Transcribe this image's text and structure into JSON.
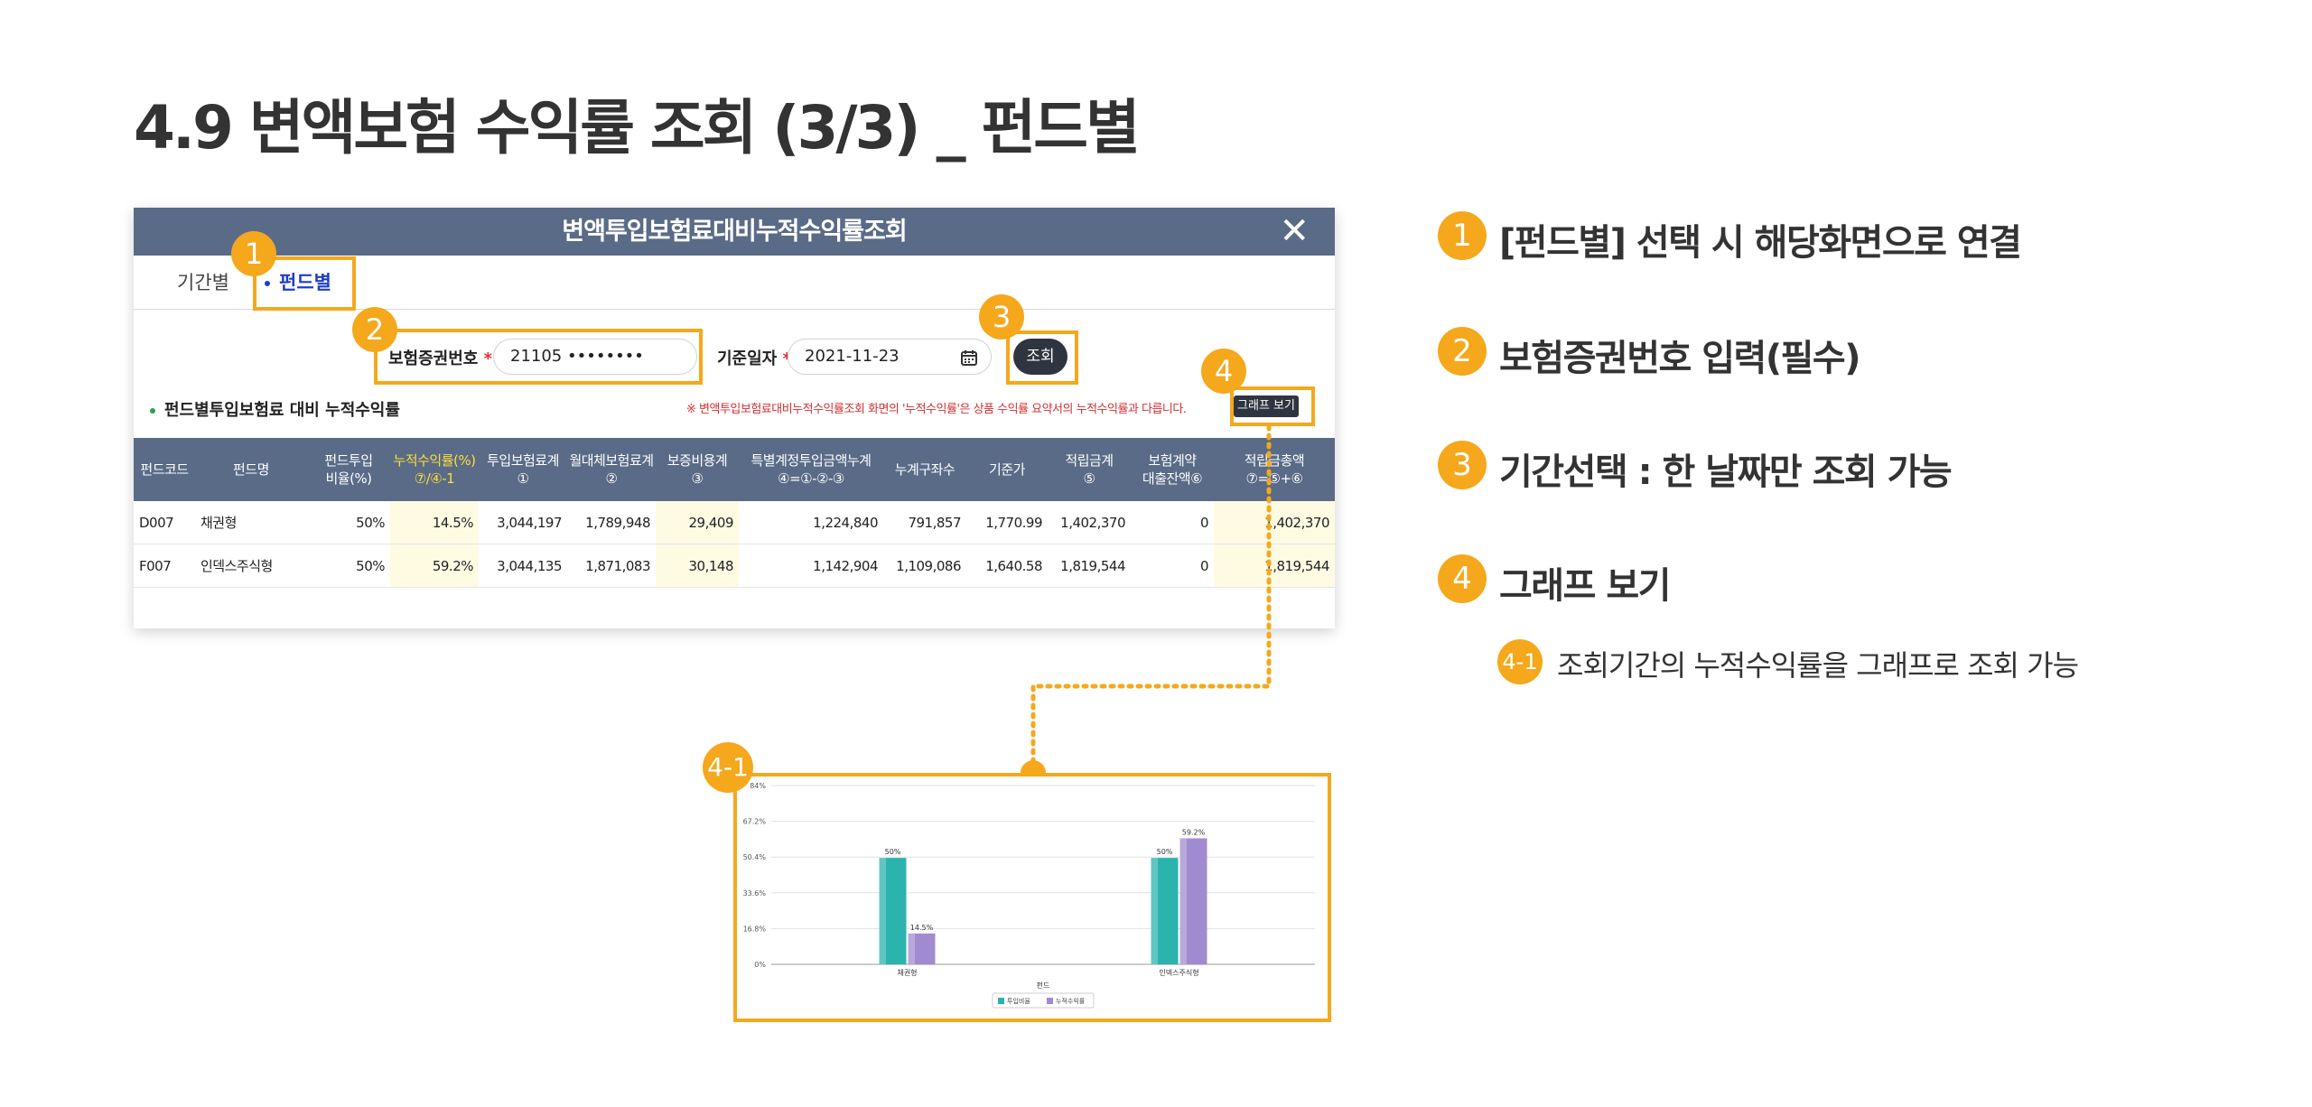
{
  "page_title": "4.9 변액보험 수익률 조회 (3/3) _ 펀드별",
  "modal": {
    "title": "변액투입보험료대비누적수익률조회",
    "close_icon": "close-icon",
    "tabs": [
      {
        "label": "기간별",
        "active": false
      },
      {
        "label": "펀드별",
        "active": true
      }
    ],
    "policy_label": "보험증권번호",
    "policy_value": "21105 ••••••••",
    "date_label": "기준일자",
    "date_value": "2021-11-23",
    "required_mark": "*",
    "search_button": "조회",
    "section_title": "펀드별투입보험료 대비 누적수익률",
    "notice": "※ 변액투입보험료대비누적수익률조회 화면의 '누적수익률'은 상품 수익률 요약서의 누적수익률과 다릅니다.",
    "graph_button": "그래프 보기",
    "table": {
      "headers": [
        [
          "펀드코드"
        ],
        [
          "펀드명"
        ],
        [
          "펀드투입",
          "비율(%)"
        ],
        [
          "누적수익률(%)",
          "⑦/④-1"
        ],
        [
          "투입보험료계",
          "①"
        ],
        [
          "월대체보험료계",
          "②"
        ],
        [
          "보증비용계",
          "③"
        ],
        [
          "특별계정투입금액누계",
          "④=①-②-③"
        ],
        [
          "누계구좌수"
        ],
        [
          "기준가"
        ],
        [
          "적립금계",
          "⑤"
        ],
        [
          "보험계약",
          "대출잔액⑥"
        ],
        [
          "적립금총액",
          "⑦=⑤+⑥"
        ]
      ],
      "rows": [
        [
          "D007",
          "채권형",
          "50%",
          "14.5%",
          "3,044,197",
          "1,789,948",
          "29,409",
          "1,224,840",
          "791,857",
          "1,770.99",
          "1,402,370",
          "0",
          "1,402,370"
        ],
        [
          "F007",
          "인덱스주식형",
          "50%",
          "59.2%",
          "3,044,135",
          "1,871,083",
          "30,148",
          "1,142,904",
          "1,109,086",
          "1,640.58",
          "1,819,544",
          "0",
          "1,819,544"
        ]
      ]
    }
  },
  "callouts": {
    "c1": "1",
    "c2": "2",
    "c3": "3",
    "c4": "4",
    "c41": "4-1"
  },
  "chart_data": {
    "type": "bar",
    "categories": [
      "채권형",
      "인덱스주식형"
    ],
    "series": [
      {
        "name": "투입비율",
        "values": [
          50,
          50
        ],
        "labels": [
          "50%",
          "50%"
        ],
        "color": "#2bb3ad"
      },
      {
        "name": "누적수익률",
        "values": [
          14.5,
          59.2
        ],
        "labels": [
          "14.5%",
          "59.2%"
        ],
        "color": "#a08bd0"
      }
    ],
    "yticks": [
      "0%",
      "16.8%",
      "33.6%",
      "50.4%",
      "67.2%",
      "84%"
    ],
    "ylim": [
      0,
      84
    ],
    "xlabel": "펀드",
    "legend_position": "bottom",
    "grid": true
  },
  "descriptions": [
    {
      "num": "1",
      "text": "[펀드별] 선택 시 해당화면으로 연결"
    },
    {
      "num": "2",
      "text": "보험증권번호 입력(필수)"
    },
    {
      "num": "3",
      "text": "기간선택 : 한 날짜만 조회 가능"
    },
    {
      "num": "4",
      "text": "그래프 보기"
    }
  ],
  "sub_description": {
    "num": "4-1",
    "text": "조회기간의 누적수익률을 그래프로 조회 가능"
  },
  "colors": {
    "accent": "#f5a81c",
    "header": "#5a6b87",
    "tab_active": "#1f3ec7"
  }
}
